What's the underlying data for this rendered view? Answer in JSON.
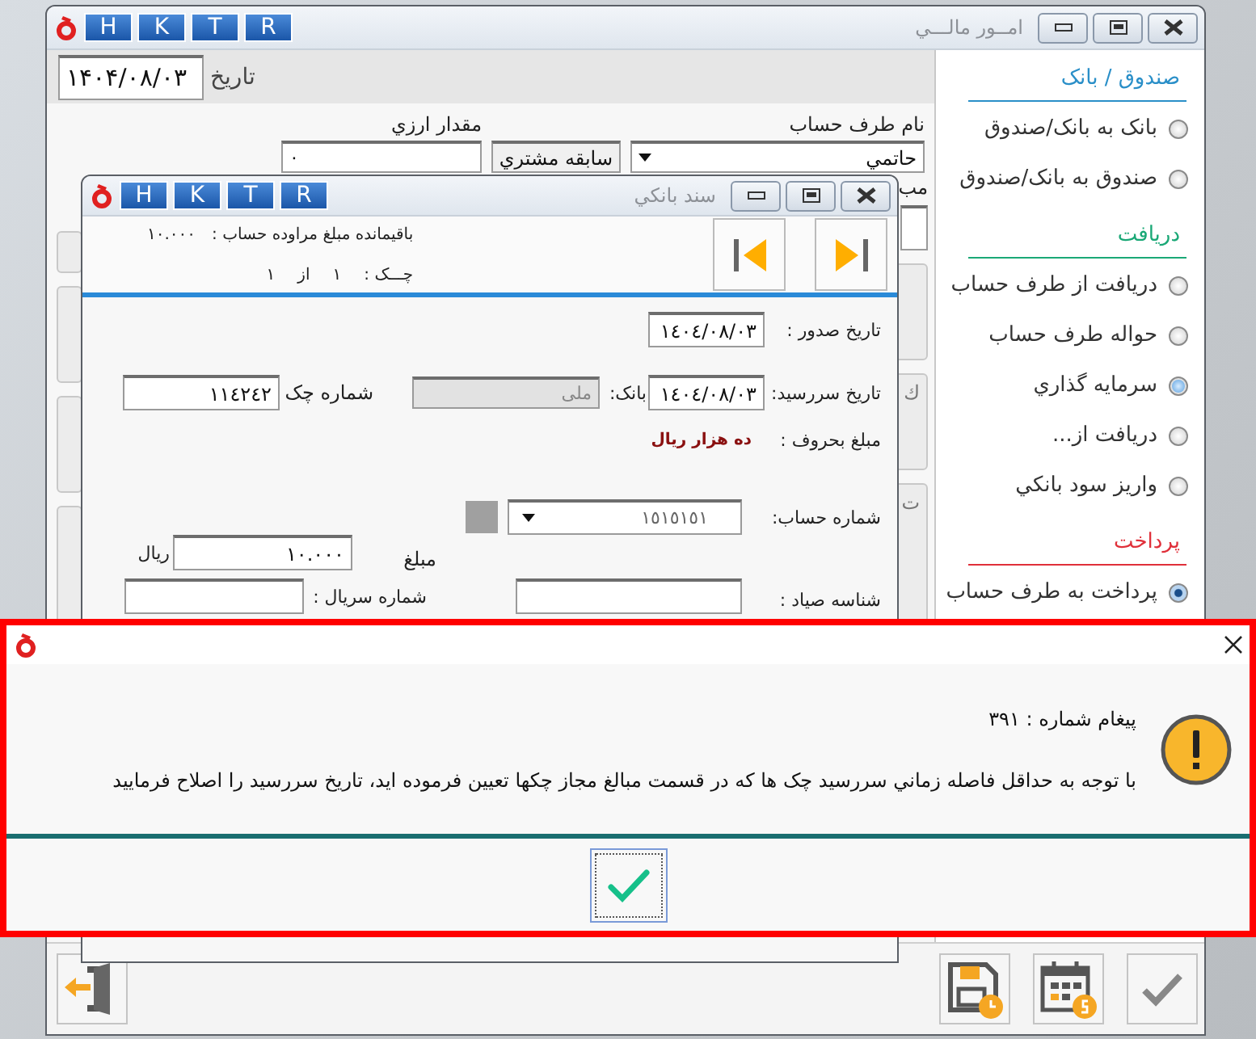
{
  "main_window": {
    "title": "امــور مالـــي",
    "hotkeys": [
      "R",
      "T",
      "K",
      "H"
    ],
    "date_label": "تاریخ",
    "date": "۱۴۰۴/۰۸/۰۳",
    "currency_amount_label": "مقدار ارزي",
    "currency_amount": "۰",
    "history_button": "سابقه مشتري",
    "party_label": "نام طرف حساب",
    "party": "حاتمي",
    "cut_labels": [
      "مب",
      "ك",
      "ت"
    ]
  },
  "sidebar": {
    "sections": [
      {
        "title": "صندوق / بانک",
        "color": "#2a8fc8",
        "items": [
          {
            "label": "بانک به بانک/صندوق",
            "selected": false,
            "hovered": false
          },
          {
            "label": "صندوق به بانک/صندوق",
            "selected": false,
            "hovered": false
          }
        ]
      },
      {
        "title": "دریافت",
        "color": "#1aa876",
        "items": [
          {
            "label": "دریافت از طرف حساب",
            "selected": false,
            "hovered": false
          },
          {
            "label": "حواله طرف حساب",
            "selected": false,
            "hovered": false
          },
          {
            "label": "سرمایه گذاري",
            "selected": false,
            "hovered": true
          },
          {
            "label": "دریافت از...",
            "selected": false,
            "hovered": false
          },
          {
            "label": "واریز سود بانکي",
            "selected": false,
            "hovered": false
          }
        ]
      },
      {
        "title": "پرداخت",
        "color": "#e0303a",
        "items": [
          {
            "label": "پرداخت به طرف حساب",
            "selected": true,
            "hovered": false
          }
        ]
      }
    ]
  },
  "voucher_window": {
    "title": "سند بانکي",
    "hotkeys": [
      "R",
      "T",
      "K",
      "H"
    ],
    "remaining_label": "باقیمانده مبلغ مراوده حساب  :",
    "remaining": "١٠.٠٠٠",
    "check_label": "چـــک  :",
    "check_index": "١",
    "of_label": "از",
    "check_total": "١",
    "issue_date_label": "تاریخ صدور  :",
    "issue_date": "١٤٠٤/٠٨/٠٣",
    "due_date_label": "تاریخ سررسید:",
    "due_date": "١٤٠٤/٠٨/٠٣",
    "bank_label": "بانک:",
    "bank": "ملی",
    "check_number_label": "شماره چک",
    "check_number": "١١٤٢٤٢",
    "amount_words_label": "مبلغ بحروف  :",
    "amount_words": "ده هزار  ریال",
    "account_number_label": "شماره حساب:",
    "account_number": "١٥١٥١٥١",
    "amount_label": "مبلغ",
    "amount": "١٠.٠٠٠",
    "currency": "ریال",
    "sayad_label": "شناسه صیاد  :",
    "serial_label": "شماره سریال :"
  },
  "message_dialog": {
    "number_label": "پیغام شماره : ۳۹۱",
    "message": "با توجه به حداقل فاصله زماني سررسيد چک ها که در قسمت مبالغ مجاز چکها تعيين فرموده ايد، تاريخ سررسيد را اصلاح فرماييد"
  }
}
